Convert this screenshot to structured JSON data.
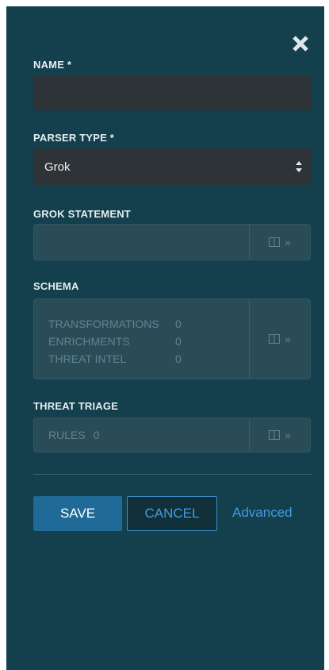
{
  "form": {
    "name_label": "NAME *",
    "name_value": "",
    "parser_type_label": "PARSER TYPE *",
    "parser_type_value": "Grok",
    "grok_statement_label": "GROK STATEMENT",
    "schema_label": "SCHEMA",
    "schema_rows": [
      {
        "key": "TRANSFORMATIONS",
        "value": "0"
      },
      {
        "key": "ENRICHMENTS",
        "value": "0"
      },
      {
        "key": "THREAT INTEL",
        "value": "0"
      }
    ],
    "threat_triage_label": "THREAT TRIAGE",
    "rules_key": "RULES",
    "rules_value": "0"
  },
  "actions": {
    "save_label": "SAVE",
    "cancel_label": "CANCEL",
    "advanced_label": "Advanced"
  },
  "icons": {
    "close": "close-icon",
    "expand": "panel-expand-icon",
    "chevron": "double-chevron-right-icon",
    "select_arrows": "select-arrows-icon"
  },
  "colors": {
    "panel_bg": "#143f4d",
    "input_bg": "#2e3337",
    "accent_blue": "#3f9ce0",
    "save_bg": "#1f6a96"
  }
}
